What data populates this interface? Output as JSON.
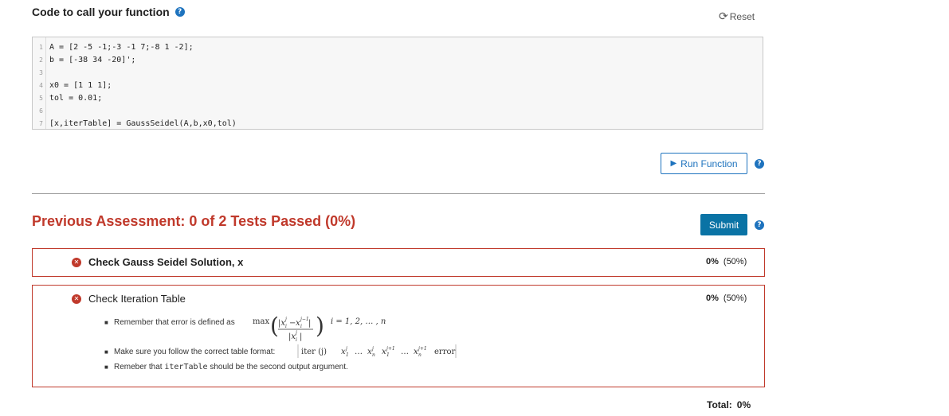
{
  "header": {
    "title": "Code to call your function",
    "help_icon": "question-circle-icon",
    "reset_label": "Reset",
    "reset_icon": "rotate-icon"
  },
  "code": {
    "lines": [
      {
        "num": "1",
        "text": "A = [2 -5 -1;-3 -1 7;-8 1 -2];"
      },
      {
        "num": "2",
        "text": "b = [-38 34 -20]';"
      },
      {
        "num": "3",
        "text": ""
      },
      {
        "num": "4",
        "text": "x0 = [1 1 1];"
      },
      {
        "num": "5",
        "text": "tol = 0.01;"
      },
      {
        "num": "6",
        "text": ""
      },
      {
        "num": "7",
        "text": "[x,iterTable] = GaussSeidel(A,b,x0,tol)"
      }
    ]
  },
  "run": {
    "label": "Run Function",
    "icon": "play-icon"
  },
  "assessment": {
    "title": "Previous Assessment: 0 of 2 Tests Passed (0%)",
    "submit_label": "Submit",
    "tests": [
      {
        "name": "Check Gauss Seidel Solution, x",
        "score": "0%",
        "weight": "(50%)",
        "status_icon": "x-circle-icon"
      },
      {
        "name": "Check Iteration Table",
        "score": "0%",
        "weight": "(50%)",
        "status_icon": "x-circle-icon",
        "notes": {
          "error_prefix": "Remember that error is defined as",
          "error_max": "max",
          "error_range": "i = 1, 2, … , n",
          "format_prefix": "Make sure you follow the correct table format:",
          "format_cols": "iter (j)   x1j  …  xnj   x1j+1  …  xnj+1   error",
          "second_prefix": "Remeber that",
          "second_code": "iterTable",
          "second_suffix": "should be the second output argument."
        }
      }
    ]
  },
  "footer": {
    "total_label": "Total:",
    "total_value": "0%"
  },
  "colors": {
    "accent": "#1e73be",
    "submit": "#0a73a5",
    "fail": "#c0392b"
  }
}
